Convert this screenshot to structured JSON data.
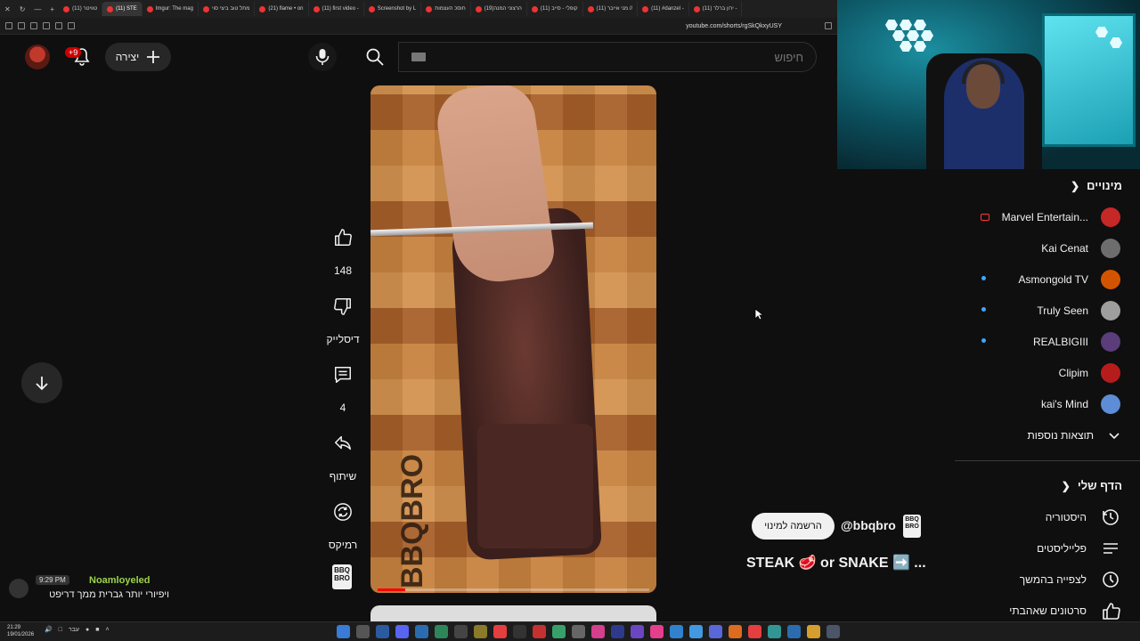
{
  "browser": {
    "tabs": [
      {
        "label": "(11) טוויטר",
        "active": false
      },
      {
        "label": "(11) STE",
        "active": true
      },
      {
        "label": "Imgur: The mag",
        "active": false
      },
      {
        "label": "מתל טוב ביצי סוי",
        "active": false
      },
      {
        "label": "(21) flame • on",
        "active": false
      },
      {
        "label": "(11) first video -",
        "active": false
      },
      {
        "label": "Screenshot by L",
        "active": false
      },
      {
        "label": "חוסכ העצמות",
        "active": false
      },
      {
        "label": "(19)הרצוני המנה",
        "active": false
      },
      {
        "label": "(11) קופלי - סייב",
        "active": false
      },
      {
        "label": "(11) מני אייבר //",
        "active": false
      },
      {
        "label": "(11) #danzel -",
        "active": false
      },
      {
        "label": "(11) ירון ברלר -",
        "active": false
      }
    ],
    "url": "youtube.com/shorts/rgSkQkxyUSY"
  },
  "header": {
    "notification_count": "+9",
    "create_label": "יצירה",
    "search_placeholder": "חיפוש"
  },
  "short": {
    "progress_fraction": 0.1,
    "brand_watermark": "BBQBRO",
    "actions": {
      "like_count": "148",
      "dislike_label": "דיסלייק",
      "comment_count": "4",
      "share_label": "שיתוף",
      "remix_label": "רמיקס",
      "channel_thumb": "BBQ BRO"
    },
    "channel_handle": "@bbqbro",
    "subscribe_label": "הרשמה למינוי",
    "caption": "STEAK 🥩 or SNAKE ➡️ ...",
    "channel_logo": "BBQ BRO"
  },
  "sidebar": {
    "subs_title": "מינויים",
    "subs": [
      {
        "name": "Marvel Entertain...",
        "color": "#c62828",
        "live": true,
        "new": false
      },
      {
        "name": "Kai Cenat",
        "color": "#6d6d6d",
        "live": false,
        "new": false
      },
      {
        "name": "Asmongold TV",
        "color": "#d35400",
        "live": false,
        "new": true
      },
      {
        "name": "Truly Seen",
        "color": "#9e9e9e",
        "live": false,
        "new": true
      },
      {
        "name": "REALBIGIII",
        "color": "#5a3d7a",
        "live": false,
        "new": true
      },
      {
        "name": "Clipim",
        "color": "#b71c1c",
        "live": false,
        "new": false
      },
      {
        "name": "kai's Mind",
        "color": "#5c8dd6",
        "live": false,
        "new": false
      }
    ],
    "more_label": "תוצאות נוספות",
    "you_title": "הדף שלי",
    "you_items": [
      {
        "label": "היסטוריה",
        "icon": "history-icon"
      },
      {
        "label": "פלייליסטים",
        "icon": "playlists-icon"
      },
      {
        "label": "לצפייה בהמשך",
        "icon": "watch-later-icon"
      },
      {
        "label": "סרטונים שאהבתי",
        "icon": "liked-icon"
      }
    ]
  },
  "chat": {
    "time": "9:29 PM",
    "user": "Noamloyeled",
    "message": "ויפיורי יותר גברית ממך דריפט"
  },
  "taskbar": {
    "time": "21:29",
    "date": "19/01/2026",
    "lang": "עבר"
  },
  "colors": {
    "accent": "#ff0000",
    "link": "#3ea6ff",
    "chat_user": "#9bd34d"
  }
}
